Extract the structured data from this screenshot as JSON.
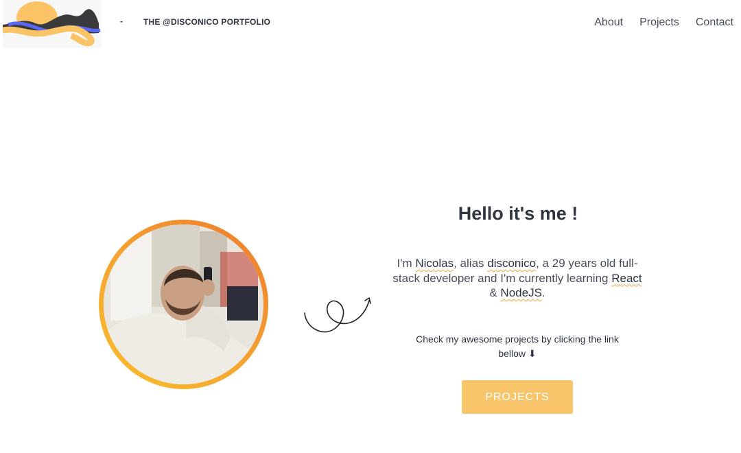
{
  "header": {
    "separator": "-",
    "brand": "THE @DISCONICO PORTFOLIO",
    "nav": [
      {
        "label": "About"
      },
      {
        "label": "Projects"
      },
      {
        "label": "Contact"
      }
    ]
  },
  "hero": {
    "title": "Hello it's me !",
    "bio": {
      "p1": "I'm ",
      "name": "Nicolas",
      "p2": ", alias ",
      "alias": "disconico",
      "p3": ", a 29 years old full-stack developer and I'm currently learning ",
      "tech1": "React",
      "p4": " & ",
      "tech2": "NodeJS",
      "p5": "."
    },
    "cta_text": "Check my awesome projects by clicking the link bellow",
    "cta_icon": "⬇",
    "button_label": "PROJECTS"
  },
  "colors": {
    "accent": "#f8c56a",
    "highlight_underline": "#f2a541",
    "text": "#2f3441",
    "ring_gradient": [
      "#f8bf2c",
      "#ee7a2d"
    ]
  }
}
